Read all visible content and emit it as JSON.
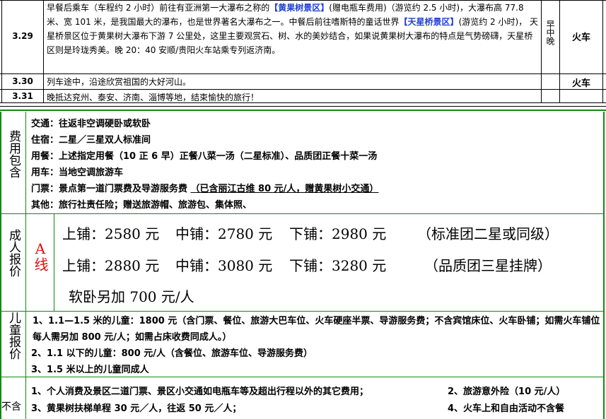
{
  "itinerary": {
    "rows": [
      {
        "date": "3.29",
        "text_parts": [
          {
            "t": "早餐后乘车（车程约 2 小时）前往有亚洲第一大瀑布之称的",
            "hl": false
          },
          {
            "t": "【黄果树景区】",
            "hl": true
          },
          {
            "t": "(赠电瓶车费用)（游览约 2.5 小时)，大瀑布高 77.8 米、宽 101 米，是我国最大的瀑布，也是世界著名大瀑布之一。中餐后前往嗜斯特的童话世界",
            "hl": false
          },
          {
            "t": "【天星桥景区】",
            "hl": true
          },
          {
            "t": "(游览约 2 小时)， 天星桥景区位于黄果树大瀑布下游 7 公里处，这里主要观赏石、树、水的美妙结合，如果说黄果树大瀑布的特点是气势磅礴，天星桥区则是玲珑秀美。晚 20：40 安顺/贵阳火车站乘专列返济南。",
            "hl": false
          }
        ],
        "meals": "早中晚",
        "transport": "火车"
      },
      {
        "date": "3.30",
        "text": "列车途中，沿途欣赏祖国的大好河山。",
        "meals": "",
        "transport": "火车"
      },
      {
        "date": "3.31",
        "text": "晚抵达兖州、泰安、济南、淄博等地，结束愉快的旅行！",
        "meals": "",
        "transport": ""
      }
    ]
  },
  "included": {
    "label": "费用包含",
    "items": [
      "交通：往返非空调硬卧或软卧",
      "住宿：二星／三星双人标准间",
      "用餐：上述指定用餐（10 正 6 早）正餐八菜一汤（二星标准）、品质团正餐十菜一汤",
      "用车：当地空调旅游车",
      "其他：旅行社责任险；赠送旅游帽、旅游包、集体照、"
    ],
    "ticket_prefix": "门票：景点第一道门票费及导游服务费 ",
    "ticket_underlined": "（已含丽江古维 80 元/人，赠黄果树小交通）"
  },
  "adult_price": {
    "label": "成人报价",
    "route": "A线",
    "line1": {
      "upper": "上铺：2580 元",
      "middle": "中铺：2780 元",
      "lower": "下铺：2980 元",
      "note": "（标准团二星或同级）"
    },
    "line2": {
      "upper": "上铺：2880 元",
      "middle": "中铺：3080 元",
      "lower": "下铺：3280 元",
      "note": "（品质团三星挂牌）"
    },
    "softsleeper": "软卧另加 700 元/人"
  },
  "child_price": {
    "label": "儿童报价",
    "items": [
      "1、1.1—1.5 米的儿童：1800 元（含门票、餐位、旅游大巴车位、火车硬座半票、导游服务费；不含宾馆床位、火车卧铺；如需火车铺位每人需另加 800 元/人；如需占床收费同成人。）",
      "2、1.1 以下的儿童：800 元/人（含餐位、旅游车位、导游服务费）",
      "3、1.5 米以上的儿童同成人"
    ]
  },
  "excluded": {
    "label": "不含",
    "items": [
      "1、个人消费及景区二道门票、景区小交通如电瓶车等及超出行程以外的其它费用；",
      "2、旅游意外险（10 元/人）",
      "3、黄果树扶梯单程 30 元／人，往返 50 元／人；",
      "4、火车上和自由活动不含餐"
    ]
  }
}
